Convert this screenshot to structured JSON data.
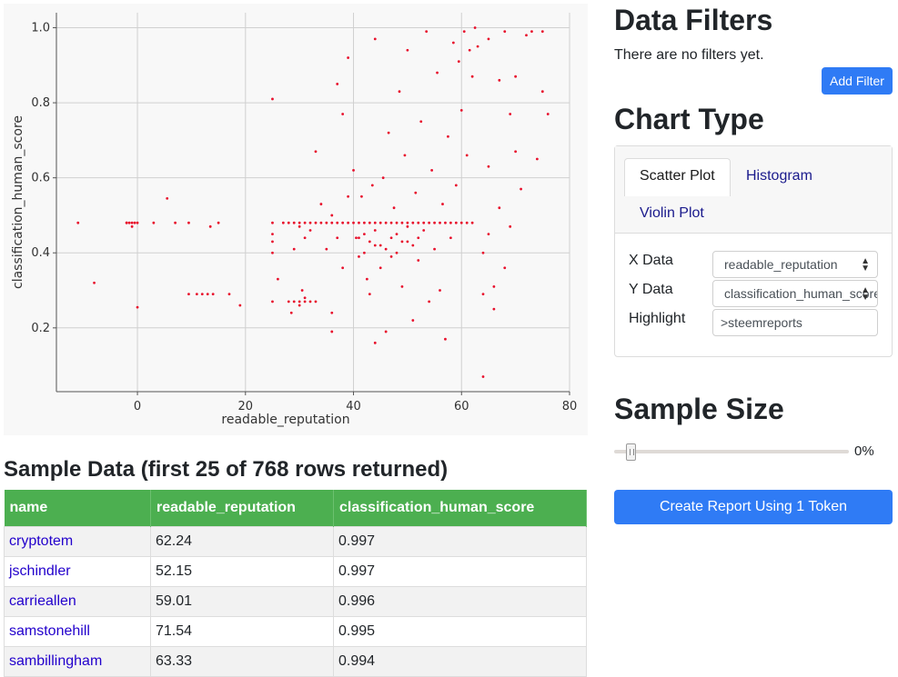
{
  "chart_data": {
    "type": "scatter",
    "xlabel": "readable_reputation",
    "ylabel": "classification_human_score",
    "xlim": [
      -15,
      80
    ],
    "ylim": [
      0.03,
      1.04
    ],
    "xticks": [
      0,
      20,
      40,
      60,
      80
    ],
    "yticks": [
      0.2,
      0.4,
      0.6,
      0.8,
      1.0
    ],
    "grid": true,
    "color": "#e8102c",
    "points": [
      [
        -11,
        0.48
      ],
      [
        -8,
        0.32
      ],
      [
        -2,
        0.48
      ],
      [
        -1.5,
        0.48
      ],
      [
        -1,
        0.48
      ],
      [
        -0.5,
        0.48
      ],
      [
        0,
        0.48
      ],
      [
        -1,
        0.47
      ],
      [
        -2,
        0.48
      ],
      [
        0,
        0.255
      ],
      [
        3,
        0.48
      ],
      [
        5.5,
        0.545
      ],
      [
        7,
        0.48
      ],
      [
        9.5,
        0.48
      ],
      [
        9.5,
        0.29
      ],
      [
        11,
        0.29
      ],
      [
        12,
        0.29
      ],
      [
        13,
        0.29
      ],
      [
        14,
        0.29
      ],
      [
        13.5,
        0.47
      ],
      [
        15,
        0.48
      ],
      [
        17,
        0.29
      ],
      [
        19,
        0.26
      ],
      [
        25,
        0.81
      ],
      [
        25,
        0.48
      ],
      [
        25,
        0.45
      ],
      [
        25,
        0.43
      ],
      [
        25,
        0.4
      ],
      [
        25,
        0.27
      ],
      [
        26,
        0.33
      ],
      [
        27,
        0.48
      ],
      [
        28,
        0.48
      ],
      [
        29,
        0.48
      ],
      [
        30,
        0.48
      ],
      [
        31,
        0.48
      ],
      [
        32,
        0.48
      ],
      [
        33,
        0.48
      ],
      [
        34,
        0.48
      ],
      [
        35,
        0.48
      ],
      [
        36,
        0.48
      ],
      [
        37,
        0.48
      ],
      [
        38,
        0.48
      ],
      [
        39,
        0.48
      ],
      [
        28,
        0.27
      ],
      [
        29,
        0.27
      ],
      [
        30,
        0.27
      ],
      [
        31,
        0.28
      ],
      [
        32,
        0.27
      ],
      [
        30,
        0.26
      ],
      [
        31,
        0.27
      ],
      [
        28.5,
        0.24
      ],
      [
        30.5,
        0.3
      ],
      [
        33,
        0.27
      ],
      [
        29,
        0.41
      ],
      [
        30,
        0.47
      ],
      [
        31,
        0.44
      ],
      [
        32,
        0.46
      ],
      [
        33,
        0.67
      ],
      [
        34,
        0.53
      ],
      [
        35,
        0.41
      ],
      [
        36,
        0.5
      ],
      [
        37,
        0.85
      ],
      [
        37,
        0.44
      ],
      [
        38,
        0.36
      ],
      [
        38,
        0.77
      ],
      [
        39,
        0.92
      ],
      [
        39,
        0.55
      ],
      [
        36,
        0.24
      ],
      [
        36,
        0.19
      ],
      [
        40,
        0.48
      ],
      [
        41,
        0.48
      ],
      [
        42,
        0.48
      ],
      [
        43,
        0.48
      ],
      [
        44,
        0.48
      ],
      [
        45,
        0.48
      ],
      [
        46,
        0.48
      ],
      [
        47,
        0.48
      ],
      [
        48,
        0.48
      ],
      [
        49,
        0.48
      ],
      [
        50,
        0.48
      ],
      [
        51,
        0.48
      ],
      [
        52,
        0.48
      ],
      [
        53,
        0.48
      ],
      [
        54,
        0.48
      ],
      [
        55,
        0.48
      ],
      [
        56,
        0.48
      ],
      [
        57,
        0.48
      ],
      [
        58,
        0.48
      ],
      [
        59,
        0.48
      ],
      [
        60,
        0.48
      ],
      [
        61,
        0.48
      ],
      [
        62,
        0.48
      ],
      [
        40,
        0.62
      ],
      [
        40.5,
        0.44
      ],
      [
        41,
        0.39
      ],
      [
        41.5,
        0.55
      ],
      [
        42,
        0.45
      ],
      [
        42.5,
        0.33
      ],
      [
        43,
        0.29
      ],
      [
        43.5,
        0.58
      ],
      [
        44,
        0.42
      ],
      [
        44,
        0.97
      ],
      [
        45,
        0.36
      ],
      [
        45.5,
        0.6
      ],
      [
        46,
        0.19
      ],
      [
        46.5,
        0.72
      ],
      [
        47,
        0.44
      ],
      [
        47.5,
        0.52
      ],
      [
        48,
        0.4
      ],
      [
        48.5,
        0.83
      ],
      [
        49,
        0.31
      ],
      [
        49.5,
        0.66
      ],
      [
        50,
        0.43
      ],
      [
        50,
        0.94
      ],
      [
        51,
        0.22
      ],
      [
        51.5,
        0.56
      ],
      [
        52,
        0.38
      ],
      [
        52.5,
        0.75
      ],
      [
        53,
        0.46
      ],
      [
        53.5,
        0.99
      ],
      [
        54,
        0.27
      ],
      [
        54.5,
        0.62
      ],
      [
        55,
        0.41
      ],
      [
        55.5,
        0.88
      ],
      [
        56,
        0.3
      ],
      [
        56.5,
        0.53
      ],
      [
        57,
        0.17
      ],
      [
        57.5,
        0.71
      ],
      [
        58,
        0.44
      ],
      [
        58.5,
        0.96
      ],
      [
        59,
        0.58
      ],
      [
        59.5,
        0.91
      ],
      [
        60,
        0.78
      ],
      [
        60.5,
        0.99
      ],
      [
        61,
        0.66
      ],
      [
        61.5,
        0.94
      ],
      [
        62,
        0.87
      ],
      [
        62.5,
        1.0
      ],
      [
        63,
        0.95
      ],
      [
        44,
        0.16
      ],
      [
        41,
        0.44
      ],
      [
        42,
        0.4
      ],
      [
        43,
        0.43
      ],
      [
        44,
        0.46
      ],
      [
        45,
        0.42
      ],
      [
        46,
        0.41
      ],
      [
        47,
        0.39
      ],
      [
        48,
        0.45
      ],
      [
        49,
        0.43
      ],
      [
        50,
        0.47
      ],
      [
        51,
        0.42
      ],
      [
        52,
        0.44
      ],
      [
        64,
        0.29
      ],
      [
        64,
        0.07
      ],
      [
        66,
        0.25
      ],
      [
        66,
        0.31
      ],
      [
        65,
        0.97
      ],
      [
        67,
        0.86
      ],
      [
        68,
        0.99
      ],
      [
        69,
        0.77
      ],
      [
        70,
        0.67
      ],
      [
        71,
        0.57
      ],
      [
        72,
        0.98
      ],
      [
        73,
        0.99
      ],
      [
        74,
        0.65
      ],
      [
        75,
        0.83
      ],
      [
        76,
        0.77
      ],
      [
        75,
        0.99
      ],
      [
        64,
        0.4
      ],
      [
        65,
        0.45
      ],
      [
        65,
        0.63
      ],
      [
        67,
        0.52
      ],
      [
        68,
        0.36
      ],
      [
        69,
        0.47
      ],
      [
        70,
        0.87
      ]
    ]
  },
  "sample_data": {
    "title": "Sample Data (first 25 of 768 rows returned)",
    "columns": [
      "name",
      "readable_reputation",
      "classification_human_score"
    ],
    "rows": [
      [
        "cryptotem",
        "62.24",
        "0.997"
      ],
      [
        "jschindler",
        "52.15",
        "0.997"
      ],
      [
        "carrieallen",
        "59.01",
        "0.996"
      ],
      [
        "samstonehill",
        "71.54",
        "0.995"
      ],
      [
        "sambillingham",
        "63.33",
        "0.994"
      ]
    ]
  },
  "filters": {
    "title": "Data Filters",
    "empty_text": "There are no filters yet.",
    "add_label": "Add Filter"
  },
  "chart_type": {
    "title": "Chart Type",
    "tabs": [
      "Scatter Plot",
      "Histogram",
      "Violin Plot"
    ],
    "active_tab": "Scatter Plot",
    "x_label": "X Data",
    "x_value": "readable_reputation",
    "y_label": "Y Data",
    "y_value": "classification_human_score",
    "highlight_label": "Highlight",
    "highlight_value": ">steemreports"
  },
  "sample_size": {
    "title": "Sample Size",
    "value": 0,
    "value_text": "0%"
  },
  "report": {
    "button_label": "Create Report Using 1 Token"
  },
  "colors": {
    "accent": "#2f7bf5",
    "table_header": "#4caf50",
    "points": "#e8102c"
  }
}
